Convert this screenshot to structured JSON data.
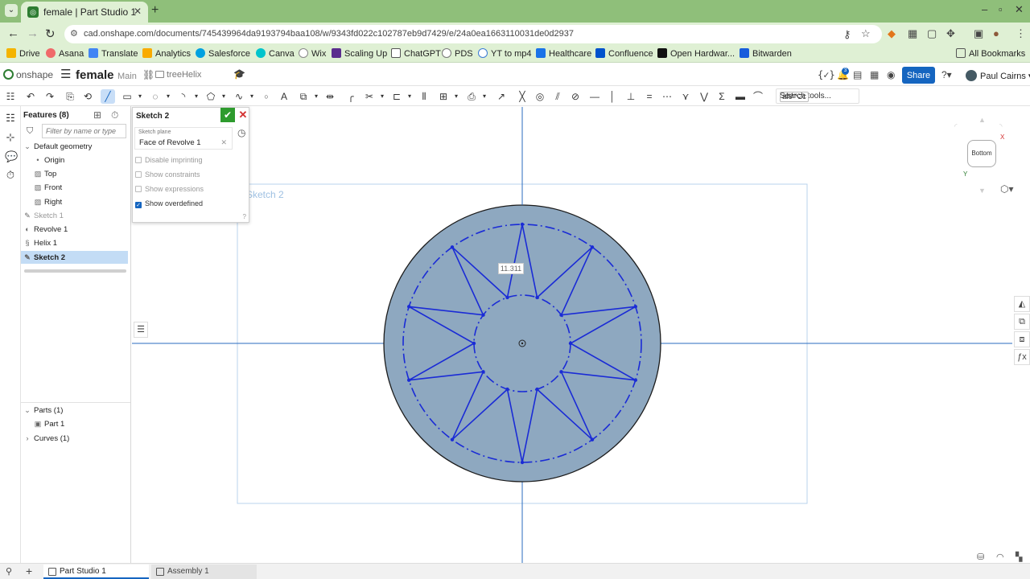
{
  "browser": {
    "tab_title": "female | Part Studio 1",
    "url": "cad.onshape.com/documents/745439964da9193794baa108/w/9343fd022c102787eb9d7429/e/24a0ea1663110031de0d2937",
    "bookmarks": [
      {
        "label": "Drive",
        "color": "#f4b400"
      },
      {
        "label": "Asana",
        "color": "#f06a6a"
      },
      {
        "label": "Translate",
        "color": "#4285f4"
      },
      {
        "label": "Analytics",
        "color": "#f9ab00"
      },
      {
        "label": "Salesforce",
        "color": "#00a1e0"
      },
      {
        "label": "Canva",
        "color": "#00c4cc"
      },
      {
        "label": "Wix",
        "color": "#222222"
      },
      {
        "label": "Scaling Up",
        "color": "#5b2d8e"
      },
      {
        "label": "ChatGPT",
        "color": "#555555"
      },
      {
        "label": "PDS",
        "color": "#777777"
      },
      {
        "label": "YT to mp4",
        "color": "#3a7bd5"
      },
      {
        "label": "Healthcare",
        "color": "#1a73e8"
      },
      {
        "label": "Confluence",
        "color": "#0052cc"
      },
      {
        "label": "Open Hardwar...",
        "color": "#111111"
      },
      {
        "label": "Bitwarden",
        "color": "#175ddc"
      }
    ],
    "all_bookmarks": "All Bookmarks"
  },
  "header": {
    "logo": "onshape",
    "doc_name": "female",
    "branch": "Main",
    "folder": "treeHelix",
    "share": "Share",
    "user": "Paul Cairns",
    "notifications": "3"
  },
  "toolbar": {
    "search_tools": "Search tools...",
    "shortcut": "alt/⌥c"
  },
  "features": {
    "title": "Features (8)",
    "filter_placeholder": "Filter by name or type",
    "default_geometry": "Default geometry",
    "items": [
      "Origin",
      "Top",
      "Front",
      "Right"
    ],
    "sketch1": "Sketch 1",
    "revolve1": "Revolve 1",
    "helix1": "Helix 1",
    "sketch2": "Sketch 2",
    "parts": "Parts (1)",
    "part1": "Part 1",
    "curves": "Curves (1)"
  },
  "sketch_dialog": {
    "title": "Sketch 2",
    "plane_label": "Sketch plane",
    "plane_value": "Face of Revolve 1",
    "disable_imprinting": "Disable imprinting",
    "show_constraints": "Show constraints",
    "show_expressions": "Show expressions",
    "show_overdefined": "Show overdefined"
  },
  "canvas": {
    "sketch_label": "Sketch 2",
    "dimension": "11.311",
    "colors": {
      "part_fill": "#8ea8c0",
      "sketch_line": "#1a2bd6",
      "axis": "#2a6bbf"
    }
  },
  "viewcube": {
    "face": "Bottom",
    "x": "X",
    "y": "Y"
  },
  "bottom_tabs": {
    "part_studio": "Part Studio 1",
    "assembly": "Assembly 1"
  }
}
